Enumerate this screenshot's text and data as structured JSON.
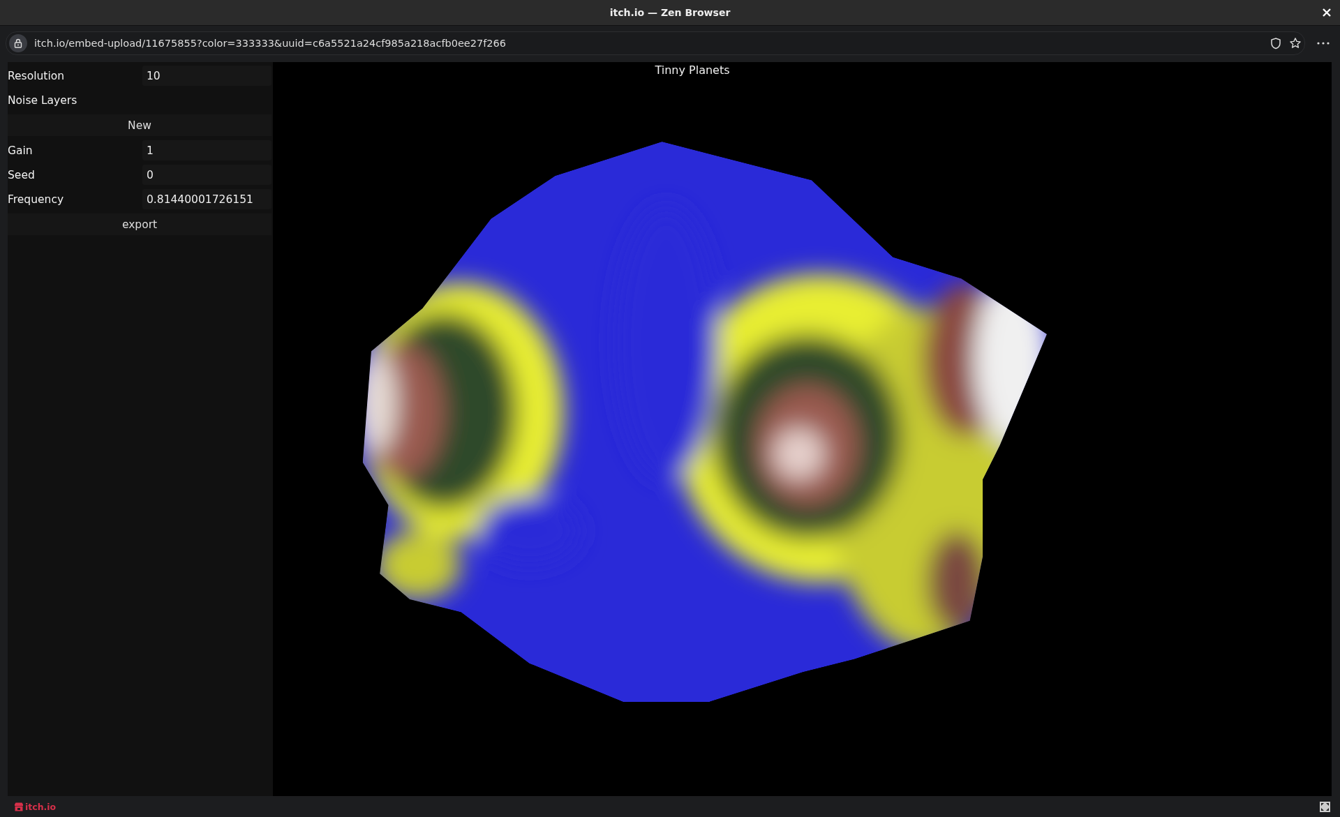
{
  "window": {
    "title": "itch.io — Zen Browser"
  },
  "address_bar": {
    "url": "itch.io/embed-upload/11675855?color=333333&uuid=c6a5521a24cf985a218acfb0ee27f266"
  },
  "panel": {
    "rows": [
      {
        "kind": "field",
        "label": "Resolution",
        "value": "10"
      },
      {
        "kind": "heading",
        "label": "Noise Layers"
      },
      {
        "kind": "button",
        "label": "New"
      },
      {
        "kind": "field",
        "label": "Gain",
        "value": "1"
      },
      {
        "kind": "field",
        "label": "Seed",
        "value": "0"
      },
      {
        "kind": "field",
        "label": "Frequency",
        "value": "0.81440001726151"
      },
      {
        "kind": "button",
        "label": "export"
      }
    ]
  },
  "canvas": {
    "title": "Tinny Planets"
  },
  "footer": {
    "brand": "itch.io"
  }
}
